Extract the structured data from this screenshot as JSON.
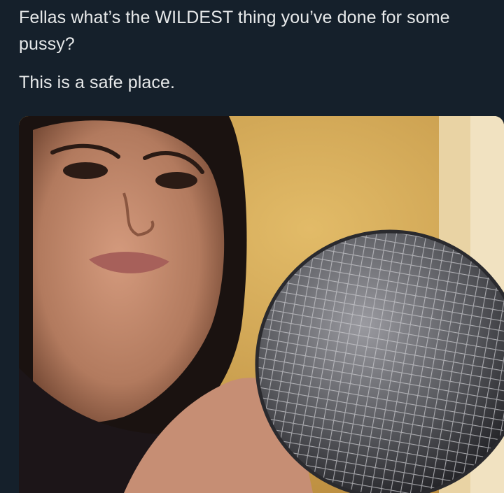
{
  "tweet": {
    "line1": "Fellas what’s the WILDEST thing you’ve done for some pussy?",
    "line2": "This is a safe place."
  },
  "media": {
    "kind": "photo",
    "subject": "woman holding a microphone toward the camera",
    "colors": {
      "wall": "#d6ae5c",
      "door": "#e9d3a4",
      "hair": "#1a1210",
      "skin": "#b27a5e",
      "mic_grille": "#5a5a5f"
    }
  },
  "colors": {
    "background": "#15202b",
    "text": "#e7e9ea"
  }
}
